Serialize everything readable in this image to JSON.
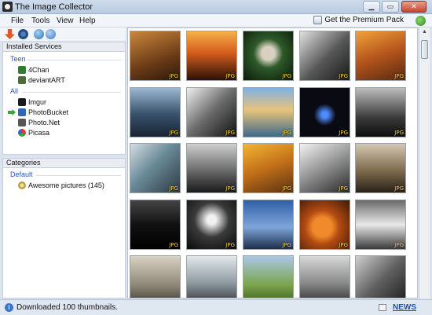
{
  "window": {
    "title": "The Image Collector"
  },
  "menu": [
    "File",
    "Tools",
    "View",
    "Help"
  ],
  "premium_label": "Get the Premium Pack",
  "services": {
    "header": "Installed Services",
    "groups": [
      {
        "label": "Teen",
        "items": [
          "4Chan",
          "deviantART"
        ]
      },
      {
        "label": "All",
        "items": [
          "Imgur",
          "PhotoBucket",
          "Photo.Net",
          "Picasa"
        ]
      }
    ]
  },
  "categories": {
    "header": "Categories",
    "group_label": "Default",
    "items": [
      "Awesome pictures (145)"
    ]
  },
  "thumbnail_tag": "JPG",
  "status": {
    "text": "Downloaded 100 thumbnails.",
    "news_label": "NEWS"
  },
  "colors": {
    "accent": "#2a56b8",
    "selected_arrow": "#3fa13f",
    "tag": "#f3d34a"
  },
  "icons": {
    "toolbar": [
      "download-arrow-icon",
      "gear-icon",
      "globe-icon",
      "info-icon"
    ],
    "services": [
      "4chan-icon",
      "deviantart-icon",
      "imgur-icon",
      "photobucket-icon",
      "photonet-icon",
      "picasa-icon"
    ]
  }
}
